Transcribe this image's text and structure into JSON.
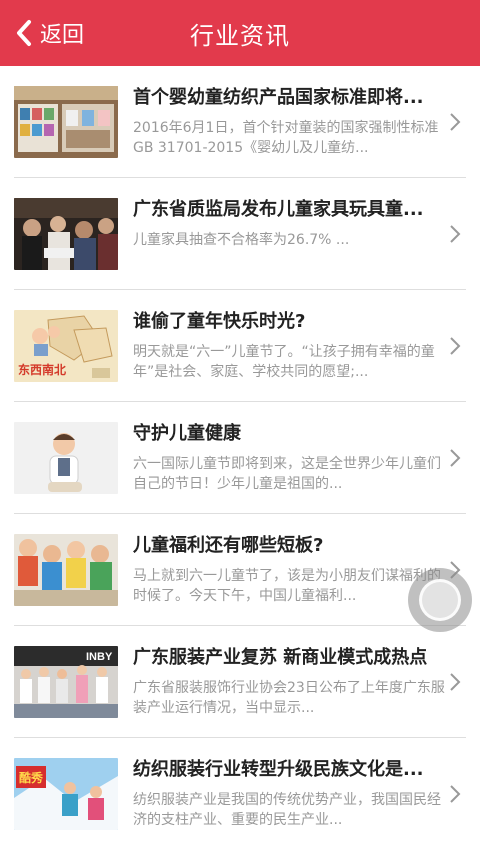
{
  "header": {
    "back_label": "返回",
    "title": "行业资讯"
  },
  "articles": [
    {
      "title": "首个婴幼童纺织产品国家标准即将...",
      "summary": "2016年6月1日，首个针对童装的国家强制性标准GB 31701-2015《婴幼儿及儿童纺...",
      "thumb": "store-shelves"
    },
    {
      "title": "广东省质监局发布儿童家具玩具童...",
      "summary": "儿童家具抽查不合格率为26.7% ...",
      "thumb": "people-crowd"
    },
    {
      "title": "谁偷了童年快乐时光?",
      "summary": "明天就是“六一”儿童节了。“让孩子拥有幸福的童年”是社会、家庭、学校共同的愿望;...",
      "thumb": "paper-illustration",
      "thumb_text": "东西南北"
    },
    {
      "title": "守护儿童健康",
      "summary": "六一国际儿童节即将到来，这是全世界少年儿童们自己的节日！少年儿童是祖国的...",
      "thumb": "child-portrait"
    },
    {
      "title": "儿童福利还有哪些短板?",
      "summary": "马上就到六一儿童节了，该是为小朋友们谋福利的时候了。今天下午，中国儿童福利...",
      "thumb": "children-group"
    },
    {
      "title": "广东服装产业复苏 新商业模式成热点",
      "summary": "广东省服装服饰行业协会23日公布了上年度广东服装产业运行情况，当中显示...",
      "thumb": "fashion-runway",
      "thumb_text": "INBY"
    },
    {
      "title": "纺织服装行业转型升级民族文化是...",
      "summary": "纺织服装产业是我国的传统优势产业，我国国民经济的支柱产业、重要的民生产业...",
      "thumb": "skiing",
      "thumb_text": "酷秀"
    }
  ]
}
